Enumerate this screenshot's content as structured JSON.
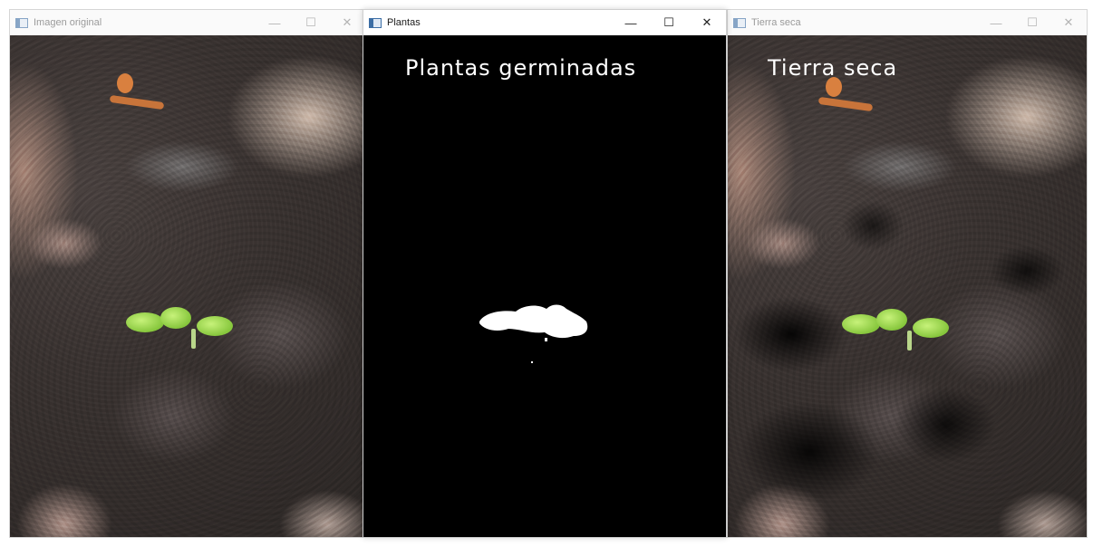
{
  "windows": [
    {
      "title": "Imagen original",
      "controls": {
        "minimize": "—",
        "maximize": "☐",
        "close": "✕"
      }
    },
    {
      "title": "Plantas",
      "overlay_text": "Plantas germinadas",
      "controls": {
        "minimize": "—",
        "maximize": "☐",
        "close": "✕"
      }
    },
    {
      "title": "Tierra seca",
      "overlay_text": "Tierra seca",
      "controls": {
        "minimize": "—",
        "maximize": "☐",
        "close": "✕"
      }
    }
  ],
  "icons": {
    "app": "app-window-icon",
    "minimize": "minimize-icon",
    "maximize": "maximize-icon",
    "close": "close-icon"
  },
  "colors": {
    "plant_green": "#9fdc55",
    "mask_white": "#ffffff",
    "mask_black": "#000000",
    "soil": "#3a3331"
  }
}
